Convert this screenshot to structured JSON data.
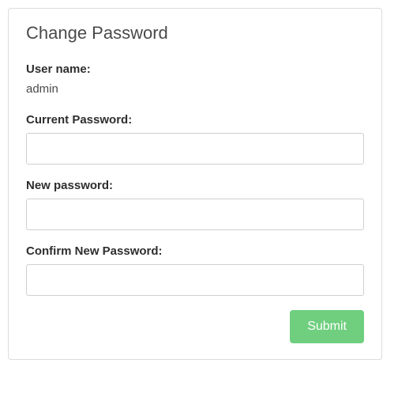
{
  "panel": {
    "title": "Change Password"
  },
  "form": {
    "username_label": "User name:",
    "username_value": "admin",
    "current_password_label": "Current Password:",
    "current_password_value": "",
    "new_password_label": "New password:",
    "new_password_value": "",
    "confirm_password_label": "Confirm New Password:",
    "confirm_password_value": "",
    "submit_label": "Submit"
  }
}
